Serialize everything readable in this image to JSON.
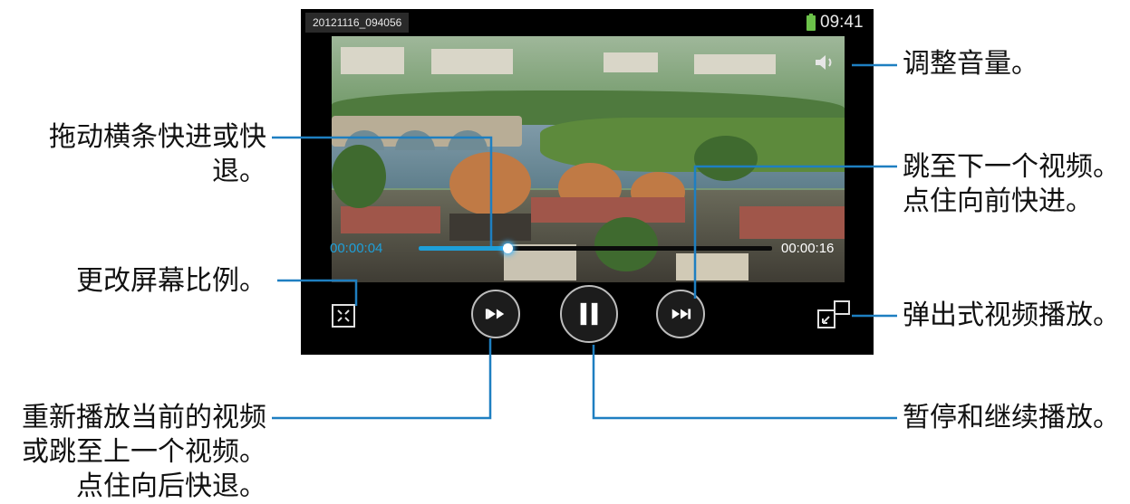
{
  "player": {
    "filename": "20121116_094056",
    "clock": "09:41",
    "elapsed": "00:00:04",
    "total": "00:00:16",
    "progress_fraction": 0.25,
    "accent_color": "#1e9fd8"
  },
  "icons": {
    "volume": "speaker-icon",
    "aspect": "fit-screen-icon",
    "rewind": "skip-back-icon",
    "pause": "pause-icon",
    "forward": "skip-forward-icon",
    "popup": "popup-window-icon",
    "battery": "battery-icon"
  },
  "callouts": {
    "volume": "调整音量。",
    "seek_line1": "拖动横条快进或快",
    "seek_line2": "退。",
    "next_line1": "跳至下一个视频。",
    "next_line2": "点住向前快进。",
    "aspect": "更改屏幕比例。",
    "popup": "弹出式视频播放。",
    "prev_line1": "重新播放当前的视频",
    "prev_line2": "或跳至上一个视频。",
    "prev_line3": "点住向后快退。",
    "pause": "暂停和继续播放。"
  }
}
